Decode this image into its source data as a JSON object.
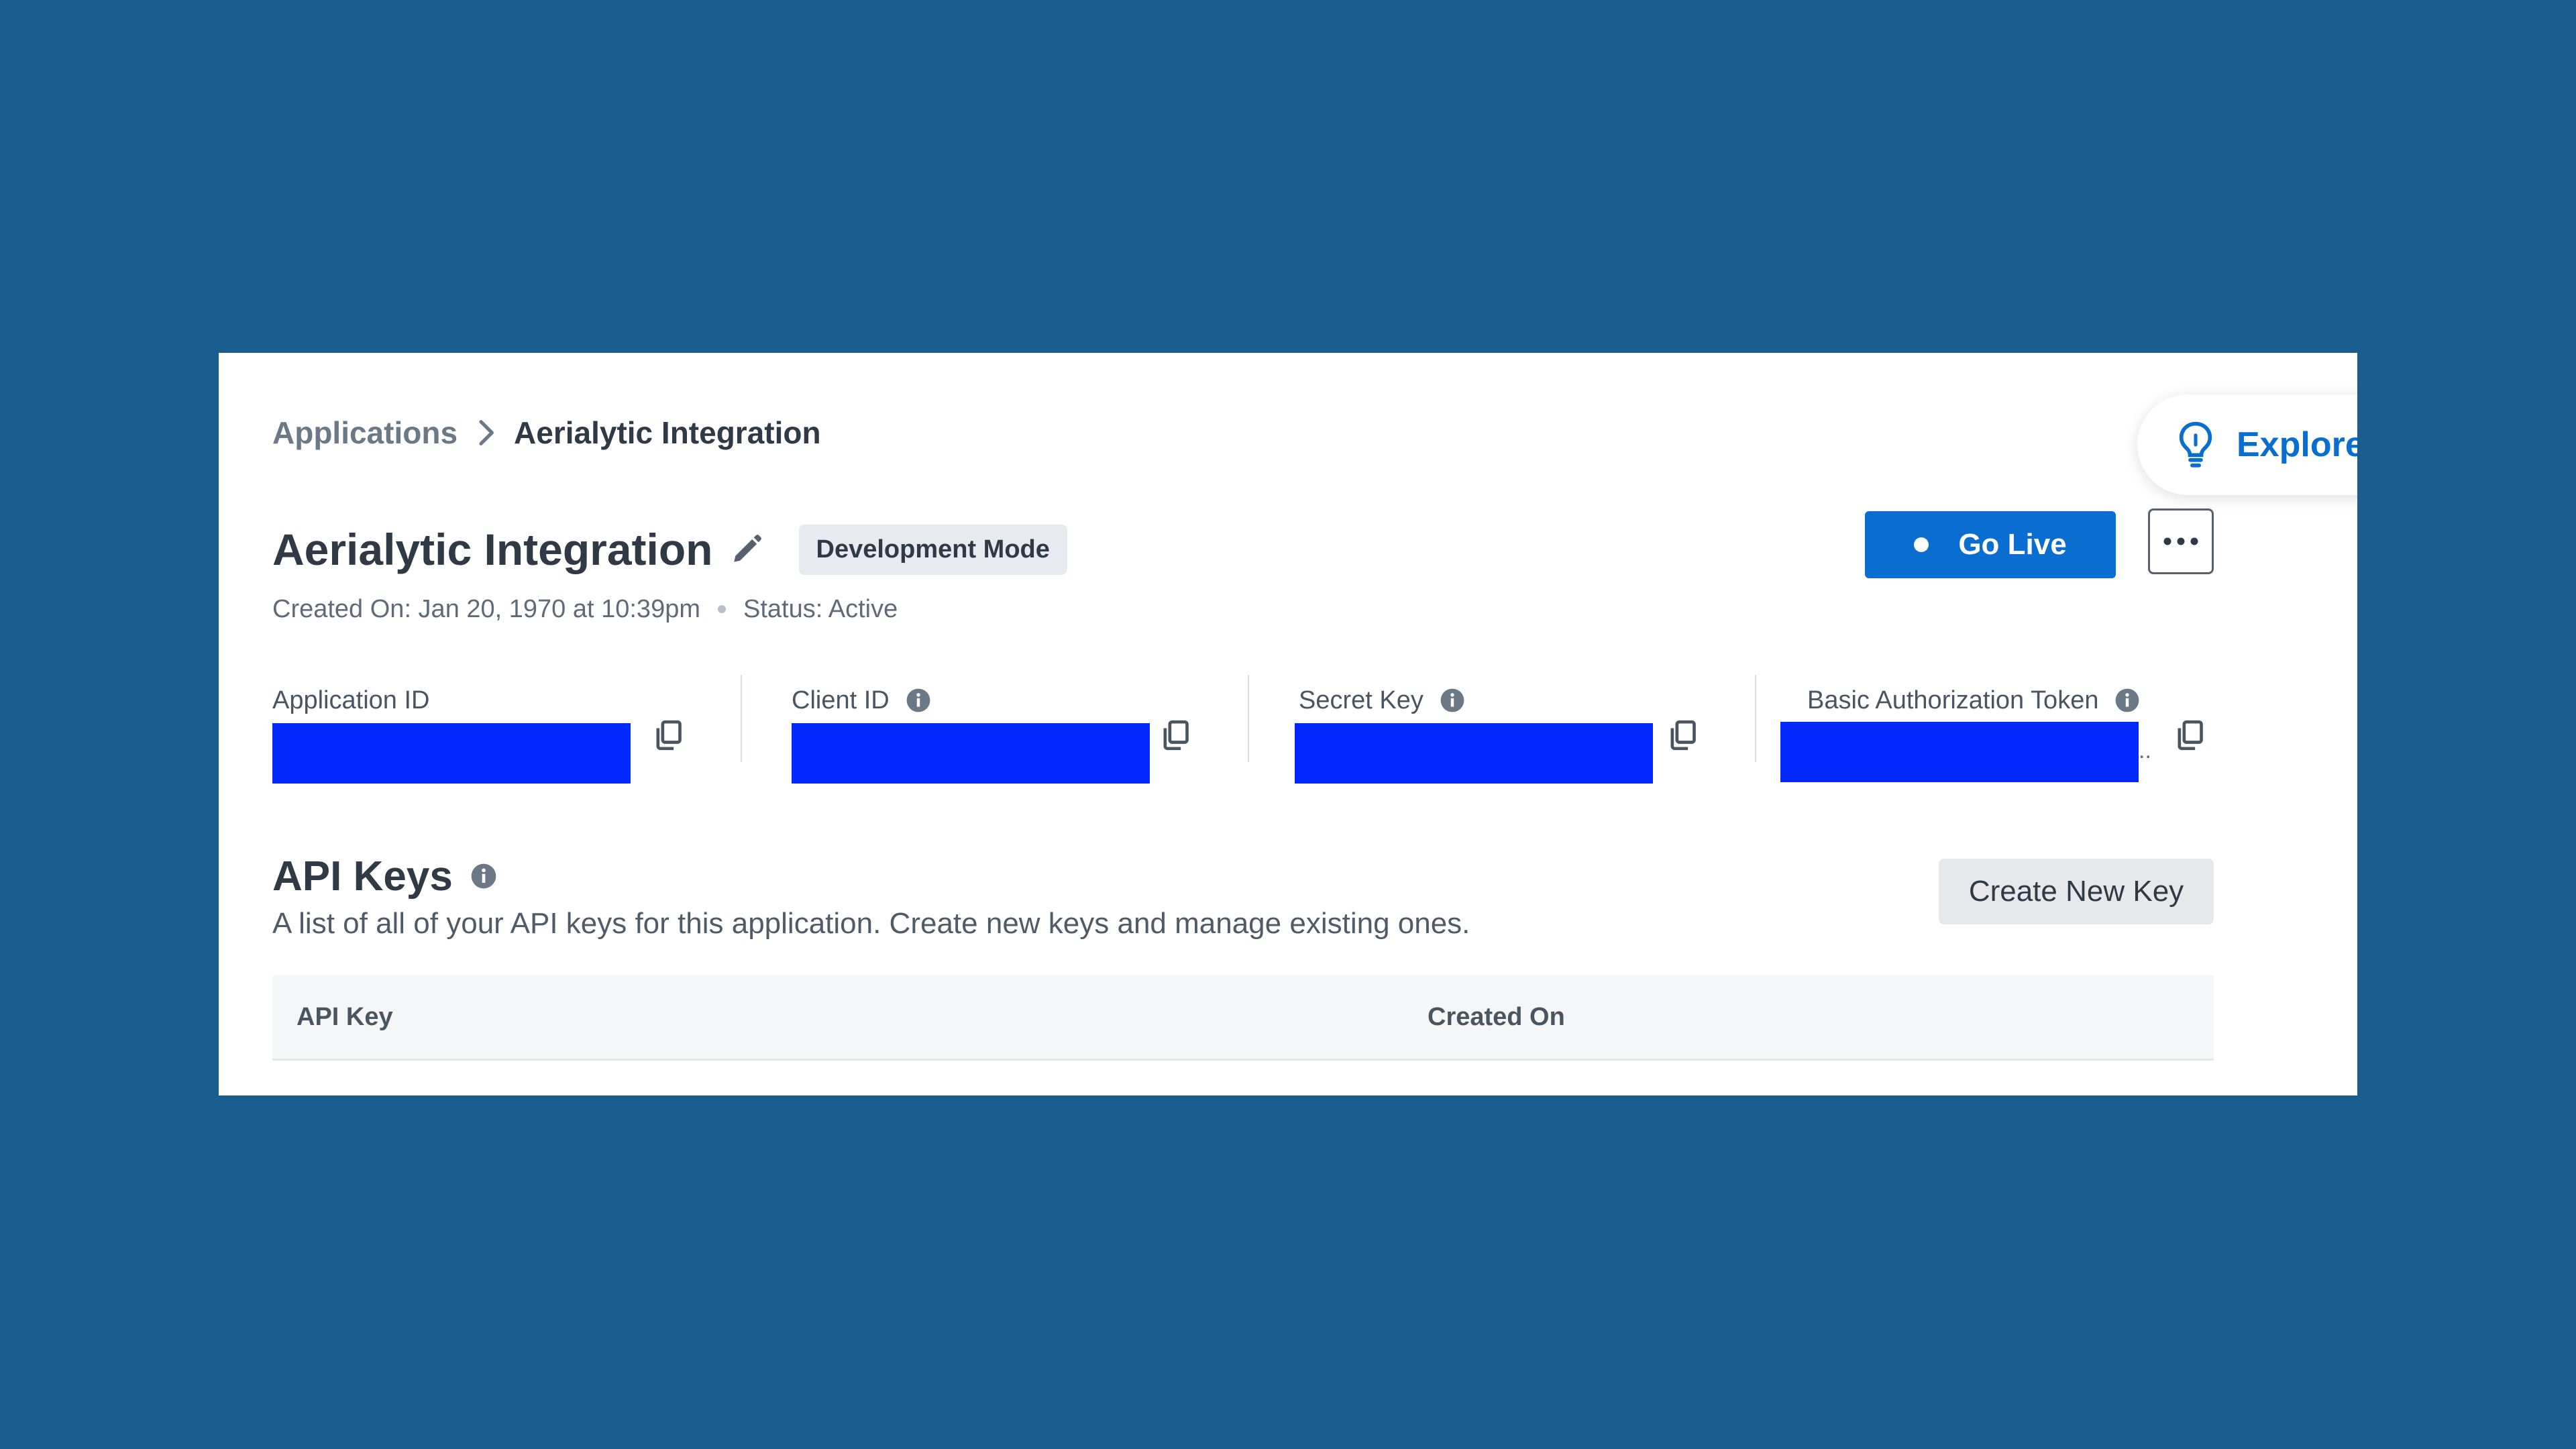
{
  "breadcrumb": {
    "parent": "Applications",
    "current": "Aerialytic Integration"
  },
  "explore": {
    "label": "Explore",
    "icon": "lightbulb-icon"
  },
  "app": {
    "title": "Aerialytic Integration",
    "mode_badge": "Development Mode",
    "created_on": "Created On: Jan 20, 1970 at 10:39pm",
    "status": "Status: Active"
  },
  "actions": {
    "go_live_label": "Go Live",
    "more_icon": "more-horizontal-icon"
  },
  "credentials": [
    {
      "label": "Application ID",
      "has_info": false
    },
    {
      "label": "Client ID",
      "has_info": true
    },
    {
      "label": "Secret Key",
      "has_info": true
    },
    {
      "label": "Basic Authorization Token",
      "has_info": true,
      "overflow_marker": ".."
    }
  ],
  "api_keys": {
    "title": "API Keys",
    "description": "A list of all of your API keys for this application. Create new keys and manage existing ones.",
    "create_label": "Create New Key",
    "columns": [
      "API Key",
      "Created On"
    ]
  },
  "colors": {
    "background": "#1a5e8f",
    "accent": "#0a6ed0",
    "redaction": "#0328fc"
  }
}
